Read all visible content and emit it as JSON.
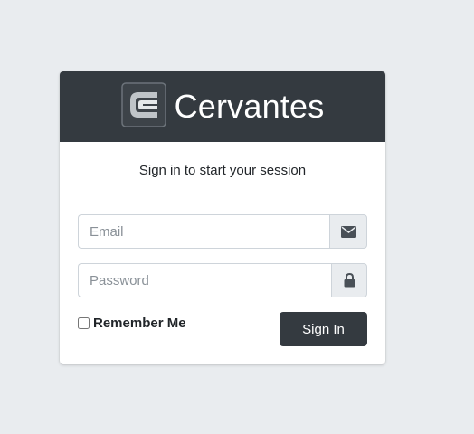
{
  "brand": {
    "name": "Cervantes",
    "logo_icon": "cervantes-c-logo"
  },
  "login": {
    "message": "Sign in to start your session",
    "email": {
      "placeholder": "Email",
      "value": "",
      "icon": "envelope-icon"
    },
    "password": {
      "placeholder": "Password",
      "value": "",
      "icon": "lock-icon"
    },
    "remember_label": "Remember Me",
    "remember_checked": false,
    "submit_label": "Sign In"
  },
  "colors": {
    "page_background": "#e9ecef",
    "header_background": "#343a40",
    "button_background": "#343a40",
    "addon_background": "#e9ecef"
  }
}
